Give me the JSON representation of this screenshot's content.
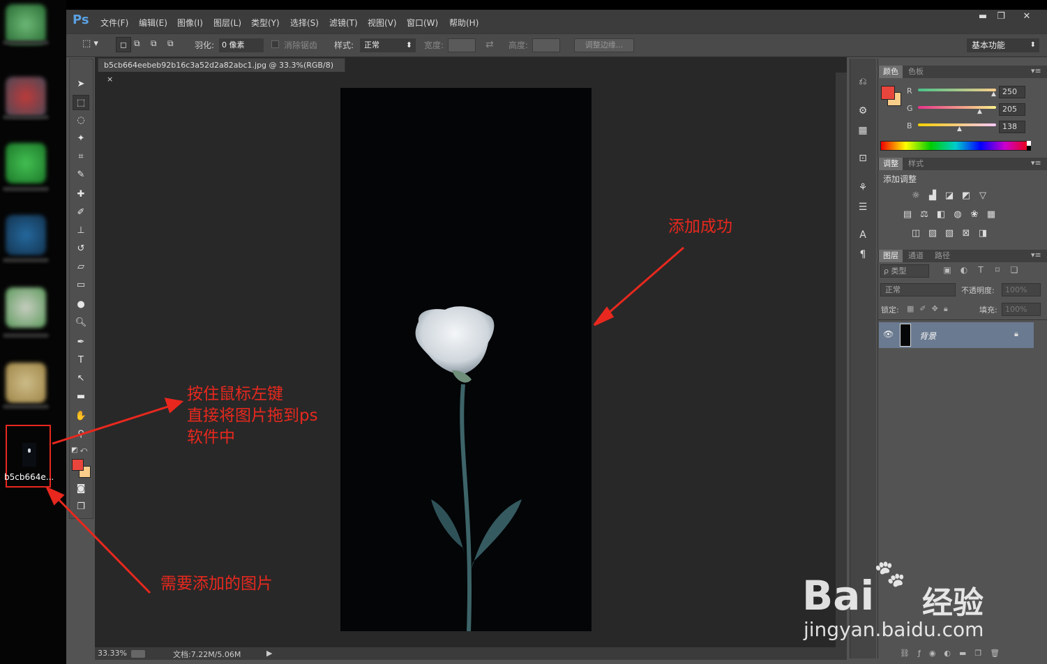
{
  "app": {
    "logo": "Ps"
  },
  "menu": [
    "文件(F)",
    "编辑(E)",
    "图像(I)",
    "图层(L)",
    "类型(Y)",
    "选择(S)",
    "滤镜(T)",
    "视图(V)",
    "窗口(W)",
    "帮助(H)"
  ],
  "window_controls": {
    "minimize": "▬",
    "restore": "❐",
    "close": "✕"
  },
  "options": {
    "feather_label": "羽化:",
    "feather_value": "0 像素",
    "antialias_label": "消除锯齿",
    "style_label": "样式:",
    "style_value": "正常",
    "width_label": "宽度:",
    "height_label": "高度:",
    "refine_button": "调整边缘...",
    "workspace": "基本功能"
  },
  "document": {
    "tab_title": "b5cb664eebeb92b16c3a52d2a82abc1.jpg @ 33.3%(RGB/8)",
    "close_glyph": "×"
  },
  "status": {
    "zoom": "33.33%",
    "doc_info": "文档:7.22M/5.06M"
  },
  "desktop": {
    "dragged_file_name": "b5cb664e..."
  },
  "color_panel": {
    "tabs": [
      "颜色",
      "色板"
    ],
    "channels": [
      {
        "label": "R",
        "value": "250"
      },
      {
        "label": "G",
        "value": "205"
      },
      {
        "label": "B",
        "value": "138"
      }
    ],
    "foreground_color": "#e8453c",
    "background_color": "#facd8a"
  },
  "adjust_panel": {
    "tabs": [
      "调整",
      "样式"
    ],
    "title": "添加调整"
  },
  "layers_panel": {
    "tabs": [
      "图层",
      "通道",
      "路径"
    ],
    "filter_label": "ρ 类型",
    "blend_mode": "正常",
    "opacity_label": "不透明度:",
    "opacity_value": "100%",
    "lock_label": "锁定:",
    "fill_label": "填充:",
    "fill_value": "100%",
    "layer_name": "背景"
  },
  "annotations": {
    "success": "添加成功",
    "drag_line1": "按住鼠标左键",
    "drag_line2": "直接将图片拖到ps",
    "drag_line3": "软件中",
    "need_image": "需要添加的图片"
  },
  "watermark": {
    "brand": "Bai",
    "brand2": "经验",
    "url": "jingyan.baidu.com"
  }
}
